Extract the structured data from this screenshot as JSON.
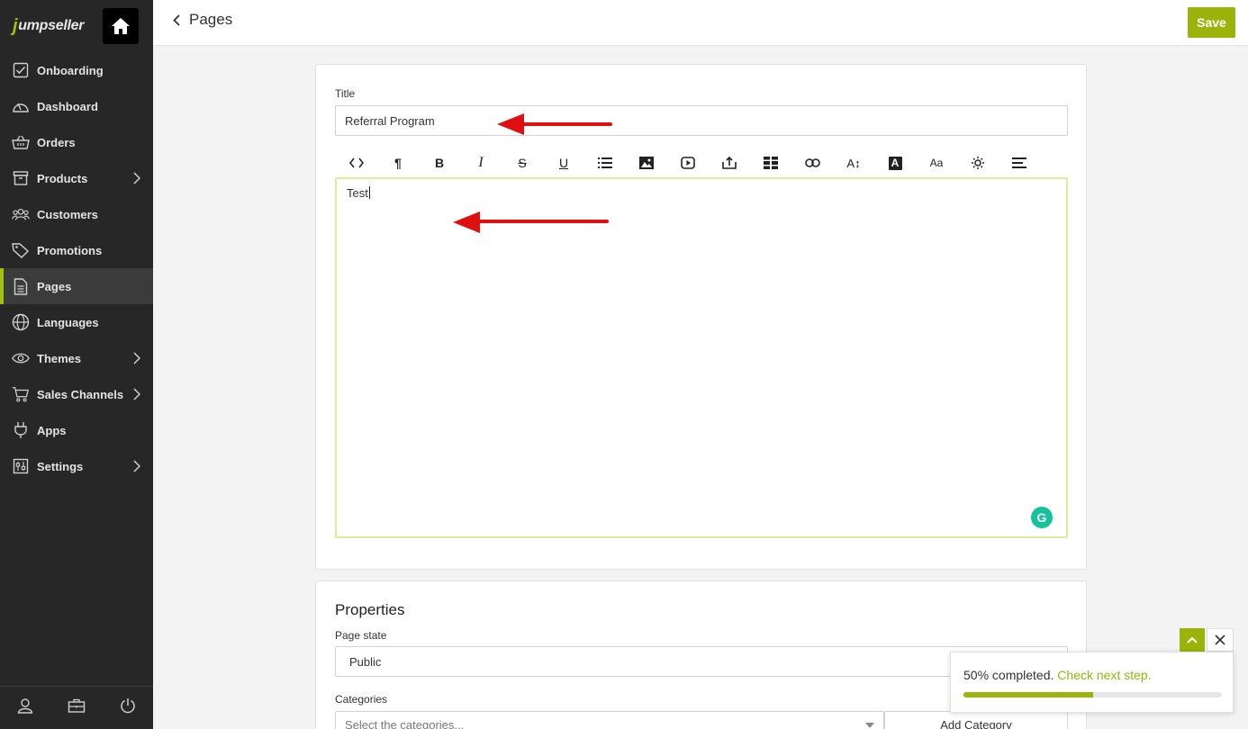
{
  "sidebar": {
    "logo": "jumpseller",
    "items": [
      {
        "label": "Onboarding",
        "icon": "checkbox-icon",
        "has_submenu": false
      },
      {
        "label": "Dashboard",
        "icon": "gauge-icon",
        "has_submenu": false
      },
      {
        "label": "Orders",
        "icon": "basket-icon",
        "has_submenu": false
      },
      {
        "label": "Products",
        "icon": "box-icon",
        "has_submenu": true
      },
      {
        "label": "Customers",
        "icon": "users-icon",
        "has_submenu": false
      },
      {
        "label": "Promotions",
        "icon": "tag-icon",
        "has_submenu": false
      },
      {
        "label": "Pages",
        "icon": "page-icon",
        "has_submenu": false,
        "active": true
      },
      {
        "label": "Languages",
        "icon": "globe-icon",
        "has_submenu": false
      },
      {
        "label": "Themes",
        "icon": "eye-icon",
        "has_submenu": true
      },
      {
        "label": "Sales Channels",
        "icon": "cart-icon",
        "has_submenu": true
      },
      {
        "label": "Apps",
        "icon": "plug-icon",
        "has_submenu": false
      },
      {
        "label": "Settings",
        "icon": "sliders-icon",
        "has_submenu": true
      }
    ],
    "bottom_icons": [
      "user-icon",
      "briefcase-icon",
      "power-icon"
    ]
  },
  "header": {
    "title": "Pages",
    "save_label": "Save"
  },
  "content_card": {
    "title_label": "Title",
    "title_value": "Referral Program",
    "editor_text": "Test",
    "toolbar_icons": [
      "code-icon",
      "paragraph-icon",
      "bold-icon",
      "italic-icon",
      "strikethrough-icon",
      "underline-icon",
      "list-icon",
      "image-icon",
      "video-icon",
      "upload-icon",
      "table-icon",
      "link-icon",
      "font-size-icon",
      "font-color-icon",
      "font-family-icon",
      "special-chars-icon",
      "align-icon"
    ],
    "toolbar_glyphs": {
      "bold": "B",
      "italic": "I",
      "strike": "S",
      "underline": "U",
      "paragraph": "¶",
      "fontsize": "A↕",
      "fontfamily": "Aa",
      "fontcolor": "A"
    }
  },
  "properties": {
    "title": "Properties",
    "page_state_label": "Page state",
    "page_state_value": "Public",
    "categories_label": "Categories",
    "categories_placeholder": "Select the categories...",
    "add_category_label": "Add Category"
  },
  "progress": {
    "text": "50% completed.",
    "link": "Check next step.",
    "fraction": 0.5
  },
  "colors": {
    "accent": "#9ab40b",
    "sidebar_bg": "#272727",
    "annotation_arrow": "#e01010"
  }
}
